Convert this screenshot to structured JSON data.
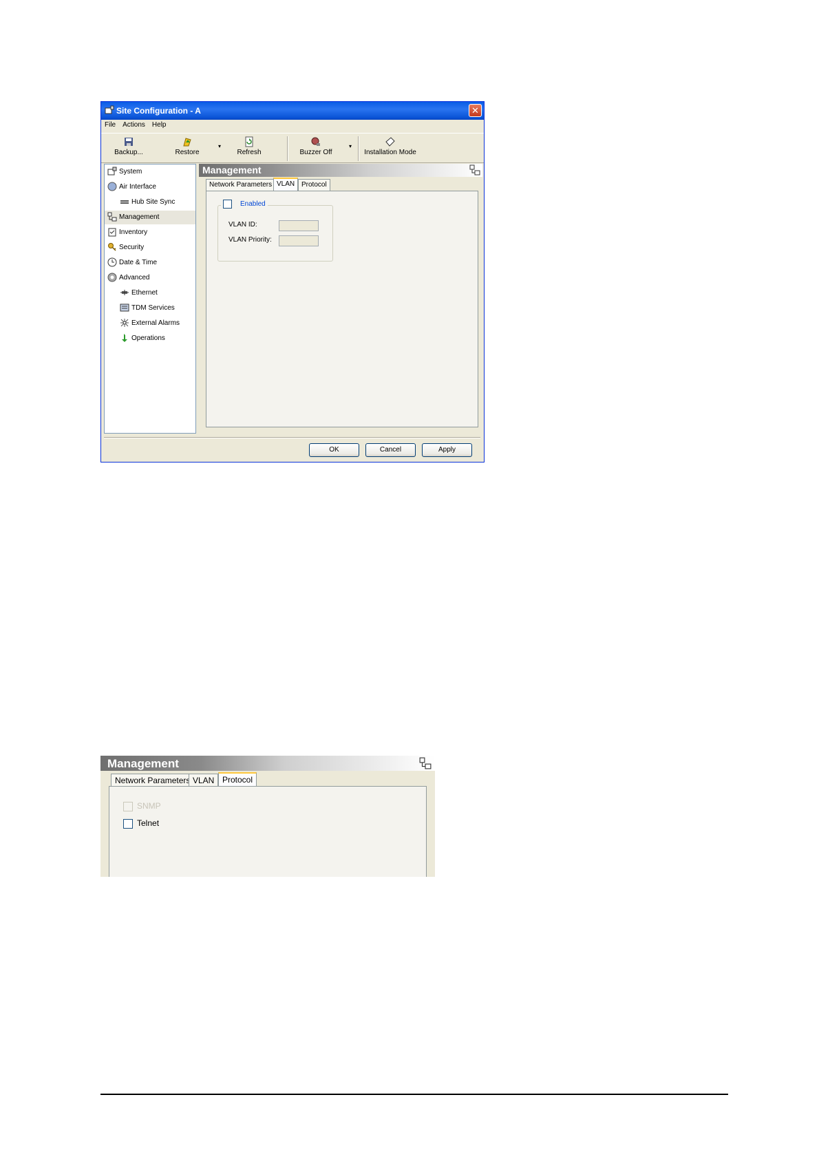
{
  "window": {
    "title": "Site Configuration - A",
    "close_glyph": "✕",
    "menu": [
      "File",
      "Actions",
      "Help"
    ],
    "toolbar": {
      "backup": "Backup...",
      "restore": "Restore",
      "refresh": "Refresh",
      "buzzer_off": "Buzzer Off",
      "installation_mode": "Installation Mode",
      "dropdown_glyph": "▾"
    },
    "tree": [
      {
        "label": "System",
        "icon": "system-icon"
      },
      {
        "label": "Air Interface",
        "icon": "air-interface-icon"
      },
      {
        "label": "Hub Site Sync",
        "icon": "hub-site-sync-icon"
      },
      {
        "label": "Management",
        "icon": "management-icon",
        "selected": true
      },
      {
        "label": "Inventory",
        "icon": "inventory-icon"
      },
      {
        "label": "Security",
        "icon": "security-icon"
      },
      {
        "label": "Date & Time",
        "icon": "clock-icon"
      },
      {
        "label": "Advanced",
        "icon": "gear-icon"
      },
      {
        "label": "Ethernet",
        "icon": "ethernet-icon"
      },
      {
        "label": "TDM Services",
        "icon": "tdm-icon"
      },
      {
        "label": "External Alarms",
        "icon": "alarm-icon"
      },
      {
        "label": "Operations",
        "icon": "operations-icon"
      }
    ],
    "panel_title": "Management",
    "tabs": [
      "Network Parameters",
      "VLAN",
      "Protocol"
    ],
    "active_tab": "VLAN",
    "vlan": {
      "enabled_label": "Enabled",
      "enabled": false,
      "vlan_id_label": "VLAN ID:",
      "vlan_id_value": "",
      "vlan_priority_label": "VLAN Priority:",
      "vlan_priority_value": ""
    },
    "buttons": {
      "ok": "OK",
      "cancel": "Cancel",
      "apply": "Apply"
    }
  },
  "protocol_panel": {
    "title": "Management",
    "tabs": [
      "Network Parameters",
      "VLAN",
      "Protocol"
    ],
    "active_tab": "Protocol",
    "options": [
      {
        "label": "SNMP",
        "checked": true,
        "disabled": true
      },
      {
        "label": "Telnet",
        "checked": false,
        "disabled": false
      }
    ]
  }
}
